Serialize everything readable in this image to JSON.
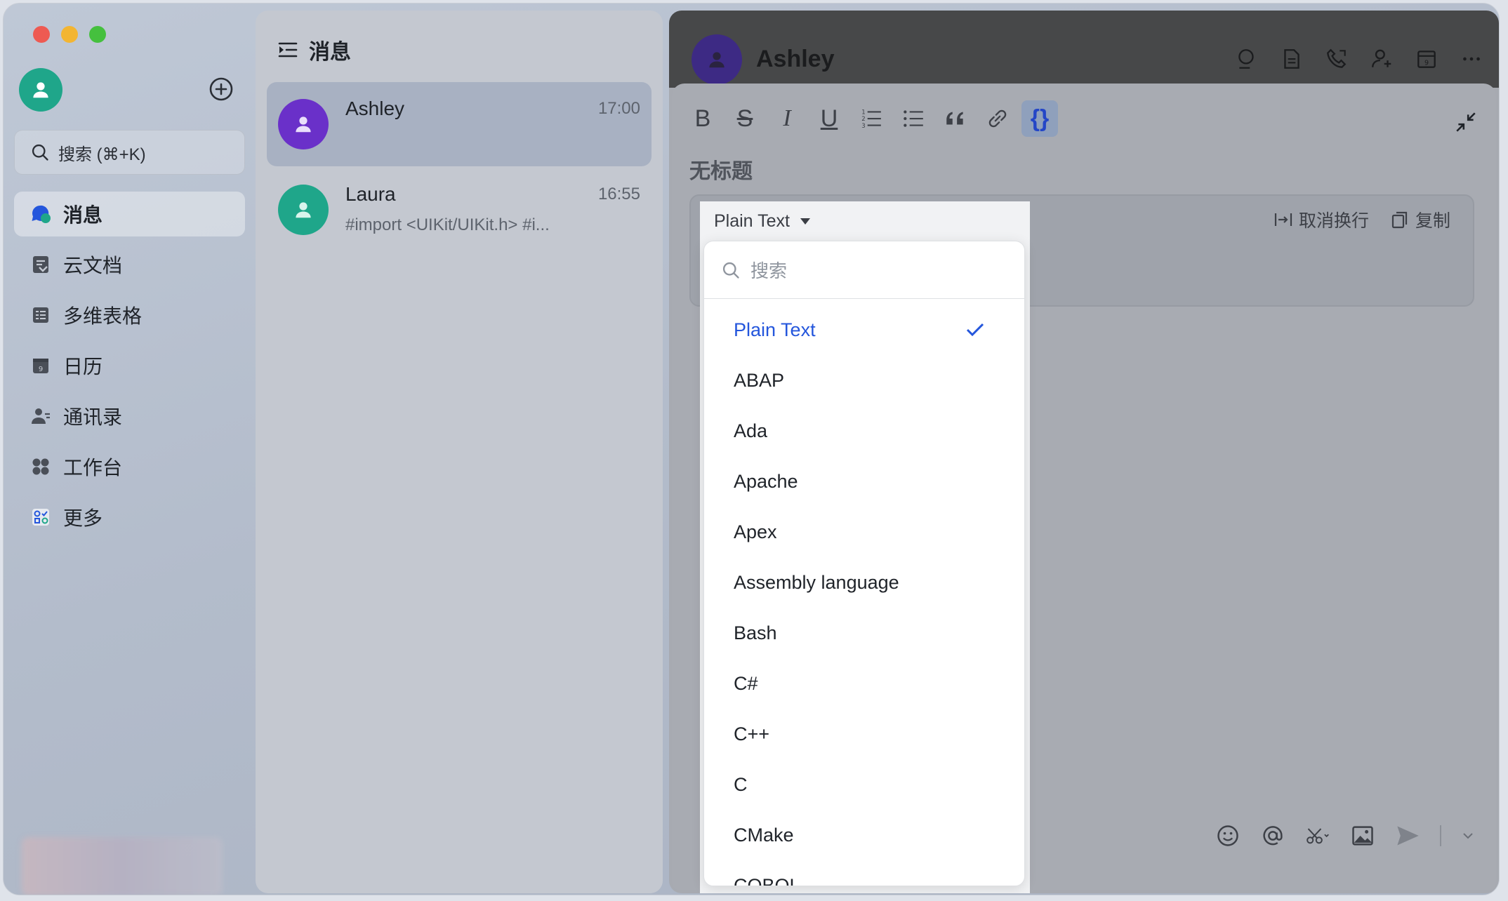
{
  "sidebar": {
    "search_placeholder": "搜索 (⌘+K)",
    "nav": [
      {
        "label": "消息",
        "icon": "chat-bubble-icon"
      },
      {
        "label": "云文档",
        "icon": "docs-icon"
      },
      {
        "label": "多维表格",
        "icon": "table-icon"
      },
      {
        "label": "日历",
        "icon": "calendar-icon"
      },
      {
        "label": "通讯录",
        "icon": "contacts-icon"
      },
      {
        "label": "工作台",
        "icon": "workbench-icon"
      },
      {
        "label": "更多",
        "icon": "more-apps-icon"
      }
    ]
  },
  "chatlist": {
    "title": "消息",
    "items": [
      {
        "name": "Ashley",
        "time": "17:00",
        "preview": "",
        "color": "#6a30c9"
      },
      {
        "name": "Laura",
        "time": "16:55",
        "preview": "#import <UIKit/UIKit.h> #i...",
        "color": "#1fa68a"
      }
    ]
  },
  "conversation": {
    "title": "Ashley",
    "doc_title": "无标题",
    "toolbar": [
      "B",
      "S",
      "I",
      "U",
      "ordered-list",
      "bullet-list",
      "quote",
      "link",
      "{}"
    ],
    "codeblock": {
      "language": "Plain Text",
      "unwrap_label": "取消换行",
      "copy_label": "复制"
    },
    "dropdown": {
      "search_placeholder": "搜索",
      "selected": "Plain Text",
      "options": [
        "Plain Text",
        "ABAP",
        "Ada",
        "Apache",
        "Apex",
        "Assembly language",
        "Bash",
        "C#",
        "C++",
        "C",
        "CMake",
        "COBOL"
      ]
    }
  },
  "colors": {
    "accent": "#2456dc",
    "me_avatar": "#1fa68a",
    "header_avatar": "#3d2a84"
  }
}
